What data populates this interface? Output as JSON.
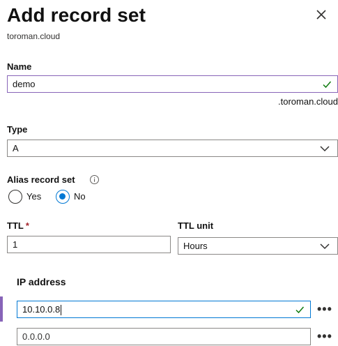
{
  "header": {
    "title": "Add record set",
    "subtitle": "toroman.cloud",
    "close_icon": "close-icon"
  },
  "form": {
    "name": {
      "label": "Name",
      "value": "demo",
      "valid_icon": "check-icon",
      "suffix": ".toroman.cloud"
    },
    "type": {
      "label": "Type",
      "value": "A",
      "dropdown_icon": "chevron-down-icon"
    },
    "alias": {
      "label": "Alias record set",
      "info_icon": "info-icon",
      "options": [
        {
          "label": "Yes",
          "checked": false
        },
        {
          "label": "No",
          "checked": true
        }
      ]
    },
    "ttl": {
      "label": "TTL",
      "required_mark": "*",
      "value": "1"
    },
    "ttl_unit": {
      "label": "TTL unit",
      "value": "Hours",
      "dropdown_icon": "chevron-down-icon"
    },
    "ip": {
      "label": "IP address",
      "rows": [
        {
          "value": "10.10.0.8",
          "more": "•••",
          "valid": true
        },
        {
          "value": "",
          "placeholder": "0.0.0.0",
          "more": "•••",
          "valid": false
        }
      ]
    }
  },
  "colors": {
    "accent_blue": "#0078d4",
    "accent_purple": "#8764b8",
    "valid_green": "#107c10",
    "required_red": "#a4262c"
  }
}
